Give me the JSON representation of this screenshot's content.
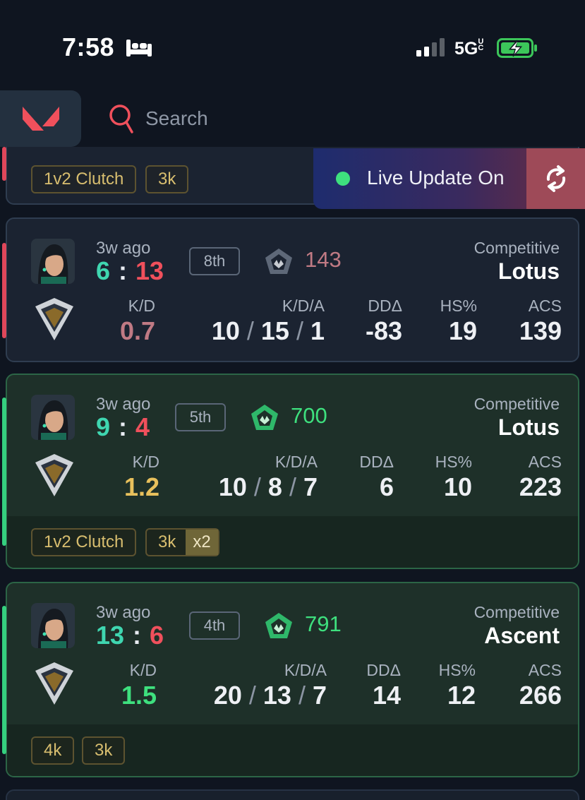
{
  "status_bar": {
    "time": "7:58",
    "network": "5G",
    "network_suffix": "UC"
  },
  "search": {
    "placeholder": "Search"
  },
  "partial_card": {
    "tags": [
      "1v2 Clutch",
      "3k"
    ]
  },
  "live_banner": {
    "label": "Live Update On"
  },
  "colors": {
    "loss": "#e0475a",
    "win": "#35d07f",
    "gold": "#d8be6f",
    "teal": "#3fd6b0",
    "red": "#f0505c"
  },
  "matches": [
    {
      "result": "loss",
      "ago": "3w ago",
      "team_score": "6",
      "enemy_score": "13",
      "placement": "8th",
      "rr": "143",
      "mode": "Competitive",
      "map": "Lotus",
      "kd_label": "K/D",
      "kd": "0.7",
      "kda_label": "K/D/A",
      "kills": "10",
      "deaths": "15",
      "assists": "1",
      "dd_label": "DDΔ",
      "dd": "-83",
      "hs_label": "HS%",
      "hs": "19",
      "acs_label": "ACS",
      "acs": "139",
      "tags": []
    },
    {
      "result": "win",
      "ago": "3w ago",
      "team_score": "9",
      "enemy_score": "4",
      "placement": "5th",
      "rr": "700",
      "mode": "Competitive",
      "map": "Lotus",
      "kd_label": "K/D",
      "kd": "1.2",
      "kda_label": "K/D/A",
      "kills": "10",
      "deaths": "8",
      "assists": "7",
      "dd_label": "DDΔ",
      "dd": "6",
      "hs_label": "HS%",
      "hs": "10",
      "acs_label": "ACS",
      "acs": "223",
      "tags": [
        "1v2 Clutch",
        "3k"
      ],
      "multiplier": "x2"
    },
    {
      "result": "win",
      "ago": "3w ago",
      "team_score": "13",
      "enemy_score": "6",
      "placement": "4th",
      "rr": "791",
      "mode": "Competitive",
      "map": "Ascent",
      "kd_label": "K/D",
      "kd": "1.5",
      "kda_label": "K/D/A",
      "kills": "20",
      "deaths": "13",
      "assists": "7",
      "dd_label": "DDΔ",
      "dd": "14",
      "hs_label": "HS%",
      "hs": "12",
      "acs_label": "ACS",
      "acs": "266",
      "tags": [
        "4k",
        "3k"
      ]
    }
  ]
}
